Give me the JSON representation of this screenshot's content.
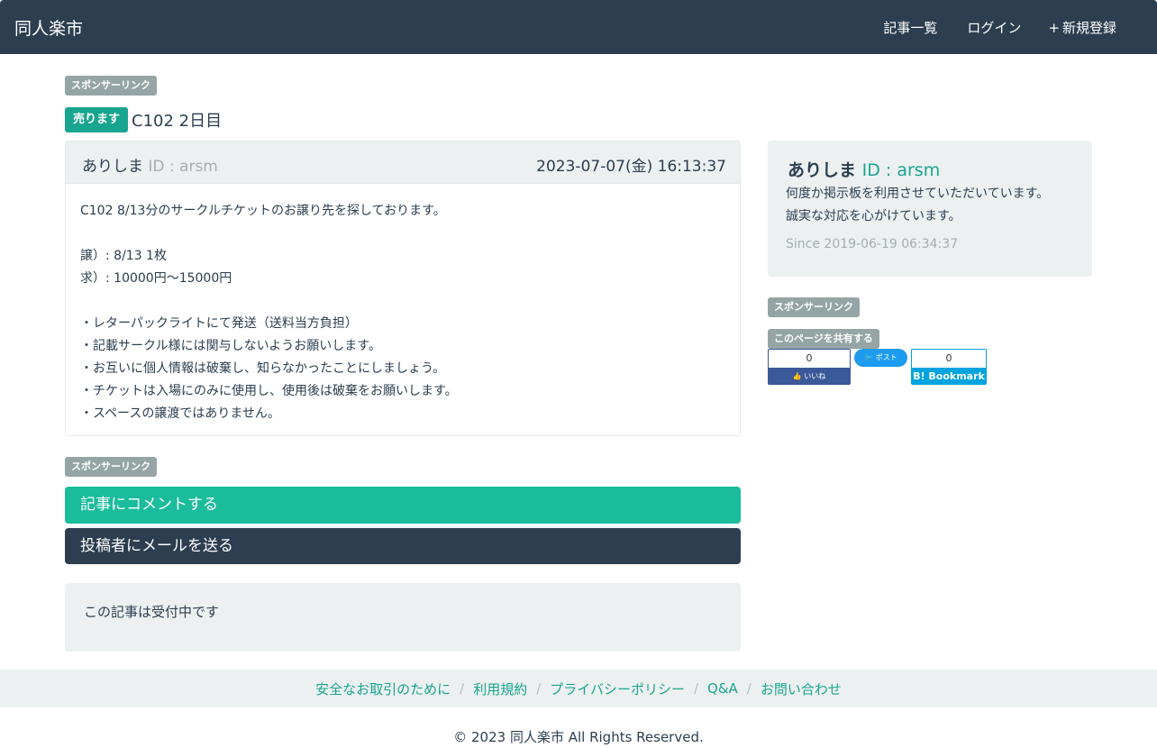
{
  "navbar": {
    "brand": "同人楽市",
    "links": [
      {
        "icon": "",
        "label": "記事一覧"
      },
      {
        "icon": "",
        "label": "ログイン"
      },
      {
        "icon": "+",
        "label": "新規登録"
      }
    ]
  },
  "sponsor_label": "スポンサーリンク",
  "post": {
    "type_badge": "売ります",
    "title": "C102 2日目",
    "author_icon": "",
    "author_name": "ありしま",
    "author_id": "ID : arsm",
    "date_icon": "",
    "date": "2023-07-07(金) 16:13:37",
    "body_lines": [
      "C102 8/13分のサークルチケットのお譲り先を探しております。",
      "",
      "譲）: 8/13 1枚",
      "求）: 10000円〜15000円",
      "",
      "・レターパックライトにて発送（送料当方負担）",
      "・記載サークル様には関与しないようお願いします。",
      "・お互いに個人情報は破棄し、知らなかったことにしましょう。",
      "・チケットは入場にのみに使用し、使用後は破棄をお願いします。",
      "・スペースの譲渡ではありません。"
    ]
  },
  "actions": {
    "comment": "記事にコメントする",
    "mail": "投稿者にメールを送る"
  },
  "status_text": "この記事は受付中です",
  "profile": {
    "icon": "",
    "name": "ありしま",
    "id": "ID : arsm",
    "bio_lines": [
      "何度か掲示板を利用させていただいています。",
      "誠実な対応を心がけています。"
    ],
    "since_icon": "",
    "since": "Since 2019-06-19 06:34:37"
  },
  "share": {
    "label": "このページを共有する",
    "fb_count": "0",
    "fb_label": "👍 いいね",
    "tw_label": "🐦 ポスト",
    "hb_count": "0",
    "hb_label": "B! Bookmark"
  },
  "footer": {
    "links": [
      "安全なお取引のために",
      "利用規約",
      "プライバシーポリシー",
      "Q&A",
      "お問い合わせ"
    ],
    "separator": "/",
    "copyright": "© 2023 同人楽市 All Rights Reserved."
  },
  "colors": {
    "navbar": "#2c3e50",
    "accent": "#1abc9c",
    "badge_sell": "#18a58f",
    "badge_gray": "#95a5a6",
    "panel": "#ecf0f1"
  }
}
